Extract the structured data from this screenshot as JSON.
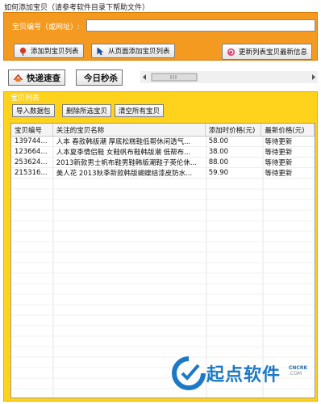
{
  "help_text": "如何添加宝贝（请参考软件目录下帮助文件）",
  "top_panel": {
    "code_label": "宝贝编号（或网址）:",
    "code_value": "",
    "add_button": "添加到宝贝列表",
    "from_page_button": "从页面添加宝贝列表",
    "update_button": "更新列表宝贝最新信息"
  },
  "toolbar": {
    "quick_speed": "快递速查",
    "today_flash": "今日秒杀"
  },
  "list_group": {
    "title": "宝贝列表",
    "import_button": "导入数据包",
    "delete_button": "删除所选宝贝",
    "clear_button": "清空所有宝贝",
    "columns": [
      "宝贝编号",
      "关注的宝贝名称",
      "添加时价格(元)",
      "最新价格(元)"
    ],
    "rows": [
      [
        "139744...",
        "人本 春款韩版潮 厚底松糕鞋低帮休闲透气...",
        "58.00",
        "等待更新"
      ],
      [
        "123664...",
        "人本夏季情侣鞋 女鞋帆布鞋韩版潮 低帮布...",
        "38.00",
        "等待更新"
      ],
      [
        "253624...",
        "2013新款男士帆布鞋男鞋韩版潮鞋子英伦休...",
        "88.00",
        "等待更新"
      ],
      [
        "215316...",
        "美人花 2013秋季新款韩版蝴蝶结漆皮防水...",
        "59.90",
        "等待更新"
      ]
    ]
  },
  "watermark": {
    "brand": "起点软件",
    "sub1": "CNCRK",
    "sub2": ".COM"
  },
  "colors": {
    "orange_panel": "#f59a20",
    "yellow_group": "#ffd21b",
    "watermark_blue": "#1c79c6"
  }
}
